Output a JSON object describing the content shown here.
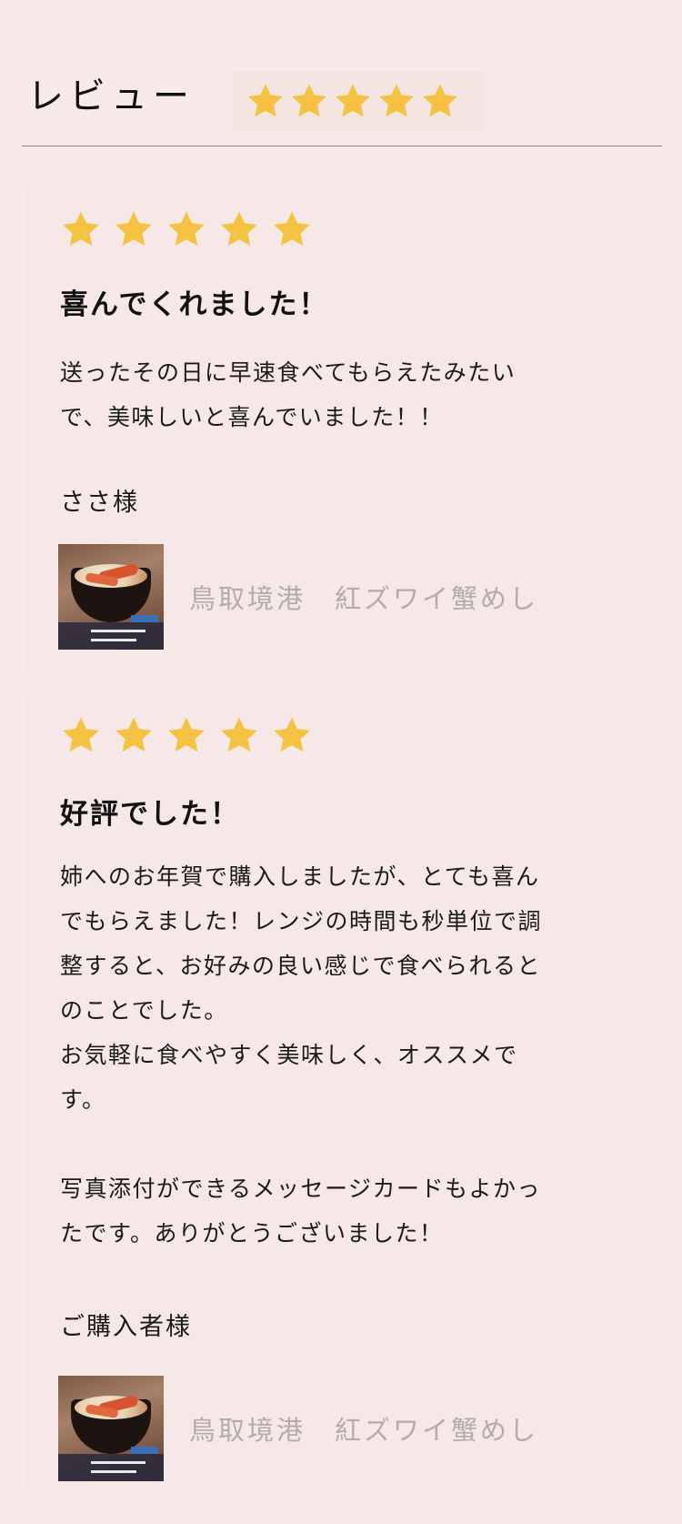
{
  "header": {
    "title": "レビュー",
    "rating": 5,
    "star_color": "#f5c342"
  },
  "reviews": [
    {
      "rating": 5,
      "title": "喜んでくれました！",
      "body": "送ったその日に早速食べてもらえたみたい\nで、美味しいと喜んでいました！！",
      "reviewer": "ささ様",
      "product": {
        "name": "鳥取境港　紅ズワイ蟹めし",
        "thumbnail_icon": "crab-rice-bowl-photo"
      }
    },
    {
      "rating": 5,
      "title": "好評でした！",
      "body": "姉へのお年賀で購入しましたが、とても喜ん\nでもらえました！レンジの時間も秒単位で調\n整すると、お好みの良い感じで食べられると\nのことでした。\nお気軽に食べやすく美味しく、オススメで\nす。\n\n写真添付ができるメッセージカードもよかっ\nたです。ありがとうございました！",
      "reviewer": "ご購入者様",
      "product": {
        "name": "鳥取境港　紅ズワイ蟹めし",
        "thumbnail_icon": "crab-rice-bowl-photo"
      }
    }
  ]
}
